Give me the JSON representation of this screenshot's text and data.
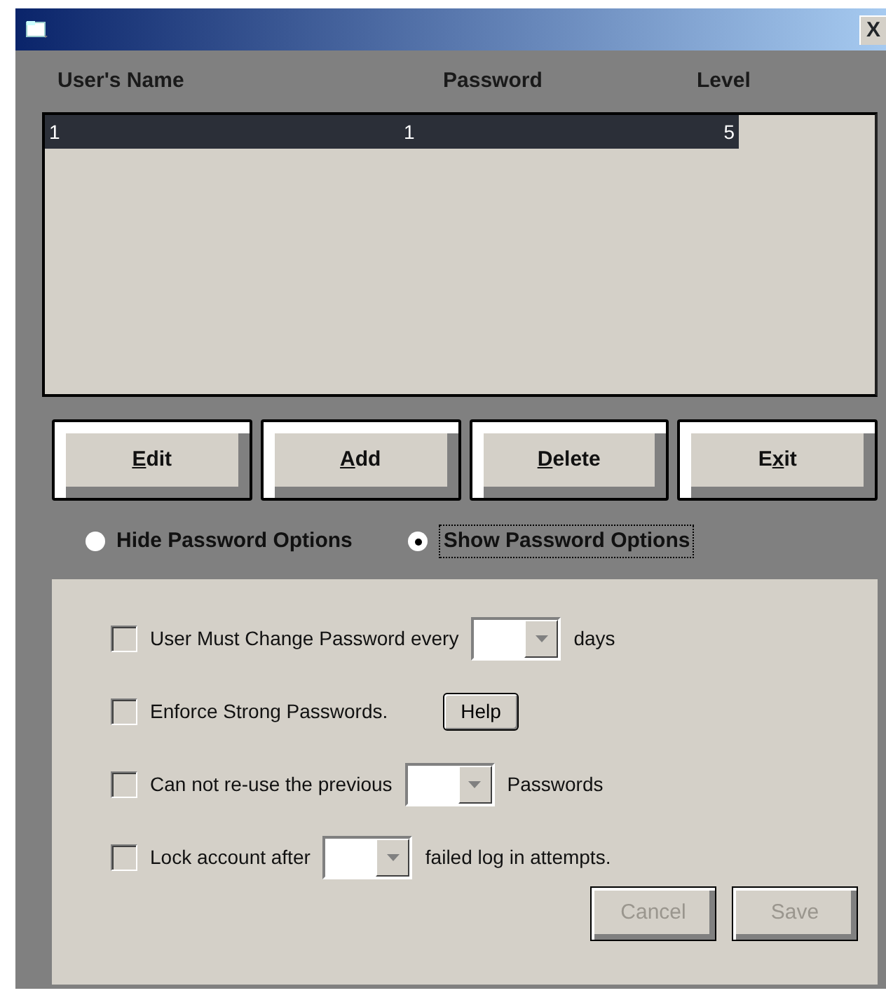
{
  "window": {
    "close_label": "X"
  },
  "table": {
    "columns": [
      "User's Name",
      "Password",
      "Level"
    ],
    "rows": [
      {
        "cells": [
          "1",
          "1",
          "5"
        ],
        "selected": true
      }
    ]
  },
  "buttons": [
    {
      "accel": "E",
      "rest": "dit"
    },
    {
      "accel": "A",
      "rest": "dd"
    },
    {
      "accel": "D",
      "rest": "elete"
    },
    {
      "lead": "E",
      "accel": "x",
      "rest": "it"
    }
  ],
  "radios": [
    {
      "label": "Hide Password Options",
      "selected": false
    },
    {
      "label": "Show Password Options",
      "selected": true
    }
  ],
  "options": [
    {
      "kind": "dropdown",
      "checked": false,
      "label": "User Must Change Password every",
      "suffix": "days"
    },
    {
      "kind": "button",
      "checked": false,
      "label": "Enforce Strong Passwords.",
      "button_label": "Help"
    },
    {
      "kind": "dropdown",
      "checked": false,
      "label": "Can not re-use the previous",
      "suffix": "Passwords"
    },
    {
      "kind": "dropdown",
      "checked": false,
      "label": "Lock account after",
      "suffix": "failed log in attempts."
    }
  ],
  "actions": [
    {
      "label": "Cancel",
      "disabled": true
    },
    {
      "label": "Save",
      "disabled": true
    }
  ]
}
